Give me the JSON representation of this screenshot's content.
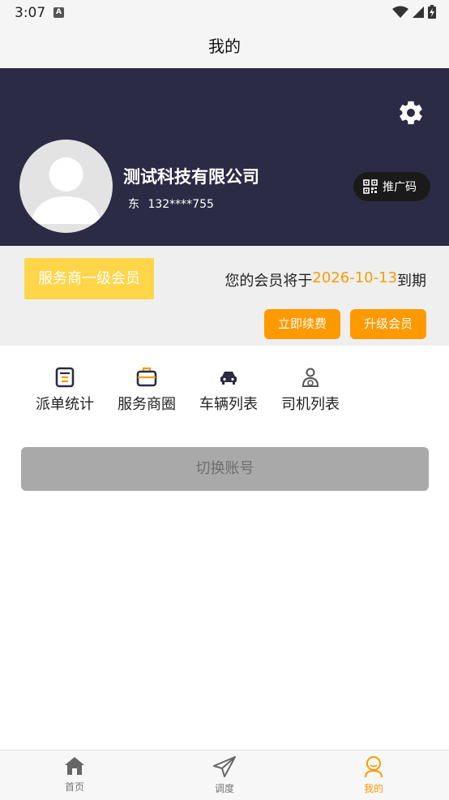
{
  "status_bar": {
    "time": "3:07",
    "notification_icon": "a-icon",
    "letter": "A"
  },
  "header": {
    "title": "我的"
  },
  "profile": {
    "company_name": "测试科技有限公司",
    "name_prefix": "东",
    "phone": "132****755",
    "qr_label": "推广码"
  },
  "membership": {
    "level": "服务商一级会员",
    "expiry_prefix": "您的会员将于",
    "expiry_date": "2026-10-13",
    "expiry_suffix": "到期",
    "renew_label": "立即续费",
    "upgrade_label": "升级会员"
  },
  "menu": {
    "items": [
      {
        "label": "派单统计",
        "icon": "document-icon"
      },
      {
        "label": "服务商圈",
        "icon": "briefcase-icon"
      },
      {
        "label": "车辆列表",
        "icon": "car-icon"
      },
      {
        "label": "司机列表",
        "icon": "driver-icon"
      }
    ]
  },
  "switch_account_label": "切换账号",
  "bottom_nav": {
    "items": [
      {
        "label": "首页",
        "icon": "home-icon"
      },
      {
        "label": "调度",
        "icon": "paper-plane-icon"
      },
      {
        "label": "我的",
        "icon": "user-icon",
        "active": true
      }
    ]
  },
  "colors": {
    "header_bg": "#2b2b45",
    "accent": "#ff9900",
    "badge": "#ffd54a",
    "disabled_button": "#a9a9a9"
  }
}
